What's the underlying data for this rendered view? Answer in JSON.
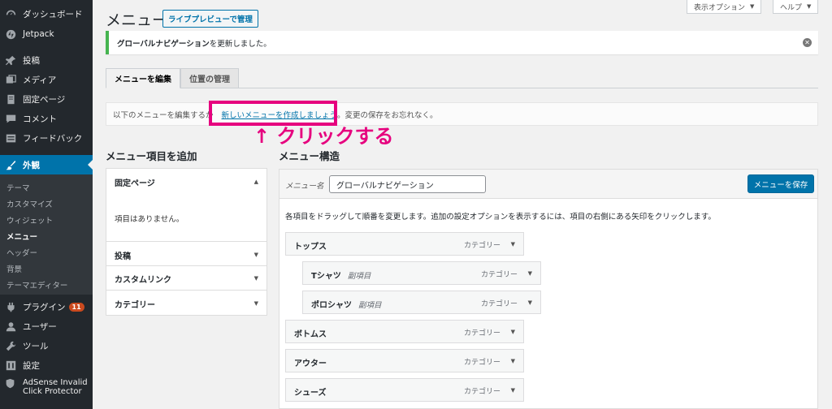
{
  "sidebar": {
    "items": [
      {
        "label": "ダッシュボード",
        "icon": "dashboard-icon"
      },
      {
        "label": "Jetpack",
        "icon": "jetpack-icon"
      },
      {
        "label": "投稿",
        "icon": "pin-icon"
      },
      {
        "label": "メディア",
        "icon": "media-icon"
      },
      {
        "label": "固定ページ",
        "icon": "page-icon"
      },
      {
        "label": "コメント",
        "icon": "comment-icon"
      },
      {
        "label": "フィードバック",
        "icon": "feedback-icon"
      },
      {
        "label": "外観",
        "icon": "brush-icon"
      },
      {
        "label": "プラグイン",
        "icon": "plugin-icon",
        "badge": "11"
      },
      {
        "label": "ユーザー",
        "icon": "user-icon"
      },
      {
        "label": "ツール",
        "icon": "wrench-icon"
      },
      {
        "label": "設定",
        "icon": "settings-icon"
      }
    ],
    "submenu": [
      "テーマ",
      "カスタマイズ",
      "ウィジェット",
      "メニュー",
      "ヘッダー",
      "背景",
      "テーマエディター"
    ],
    "adsense": {
      "line1": "AdSense Invalid",
      "line2": "Click Protector",
      "icon": "shield-icon"
    }
  },
  "header": {
    "title": "メニュー",
    "live_preview": "ライブプレビューで管理",
    "screen_options": "表示オプション",
    "help": "ヘルプ"
  },
  "notice": {
    "bold": "グローバルナビゲーション",
    "text": " を更新しました。"
  },
  "tabs": [
    "メニューを編集",
    "位置の管理"
  ],
  "manage": {
    "prefix": "以下のメニューを編集するか",
    "link": "新しいメニューを作成しましょう",
    "suffix": "。変更の保存をお忘れなく。"
  },
  "annotation": "↑ クリックする",
  "add_items": {
    "heading": "メニュー項目を追加",
    "sections": [
      "固定ページ",
      "投稿",
      "カスタムリンク",
      "カテゴリー"
    ],
    "empty": "項目はありません。"
  },
  "structure": {
    "heading": "メニュー構造",
    "name_label": "メニュー名",
    "name_value": "グローバルナビゲーション",
    "save": "メニューを保存",
    "instructions": "各項目をドラッグして順番を変更します。追加の設定オプションを表示するには、項目の右側にある矢印をクリックします。",
    "items": [
      {
        "title": "トップス",
        "type": "カテゴリー",
        "sub": ""
      },
      {
        "title": "Tシャツ",
        "type": "カテゴリー",
        "sub": "副項目"
      },
      {
        "title": "ポロシャツ",
        "type": "カテゴリー",
        "sub": "副項目"
      },
      {
        "title": "ボトムス",
        "type": "カテゴリー",
        "sub": ""
      },
      {
        "title": "アウター",
        "type": "カテゴリー",
        "sub": ""
      },
      {
        "title": "シューズ",
        "type": "カテゴリー",
        "sub": ""
      }
    ]
  },
  "colors": {
    "accent": "#0073aa",
    "sidebar": "#23282d",
    "highlight": "#e6007e",
    "notice": "#46b450"
  }
}
